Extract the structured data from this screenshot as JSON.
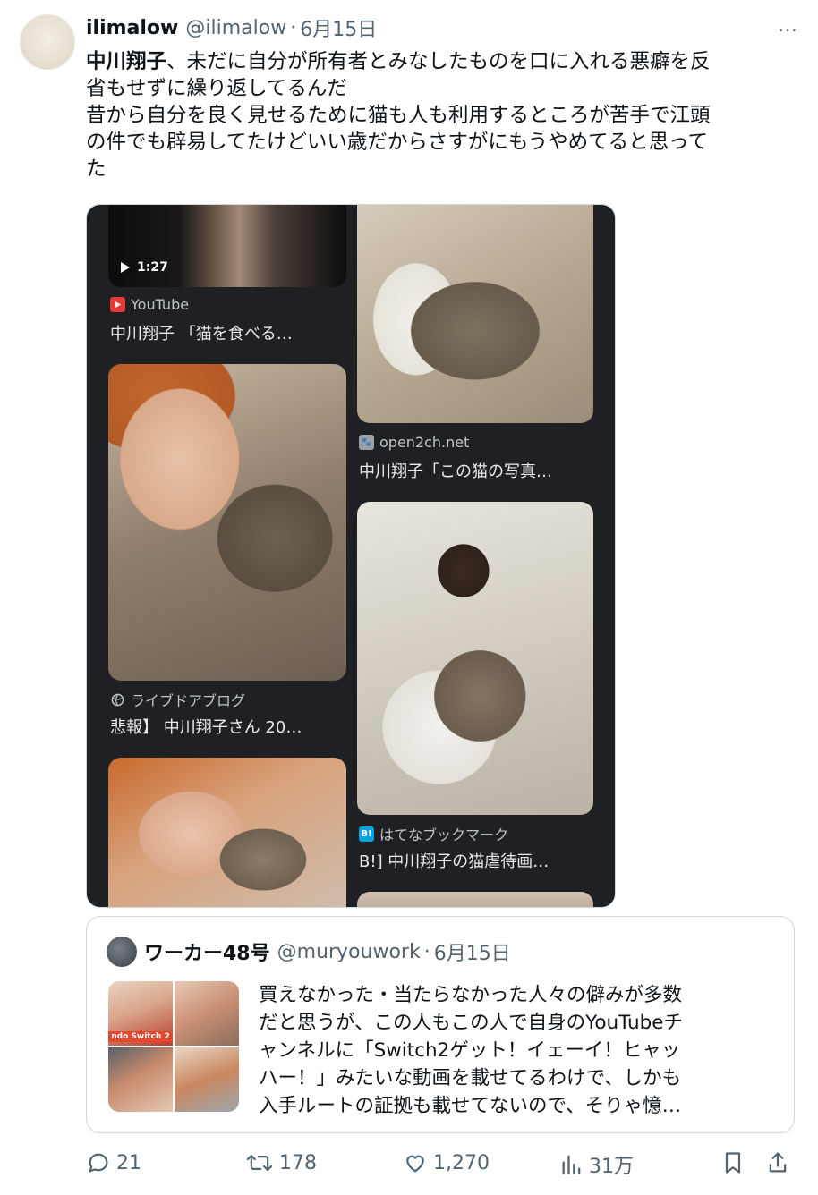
{
  "tweet": {
    "display_name": "ilimalow",
    "handle": "@ilimalow",
    "separator": "·",
    "date": "6月15日",
    "more_icon": "…",
    "text_bold": "中川翔子",
    "text_line1_rest": "、未だに自分が所有者とみなしたものを口に入れる悪癖を反",
    "text_line2": "省もせずに繰り返してるんだ",
    "text_line3": "昔から自分を良く見せるために猫も人も利用するところが苦手で江頭",
    "text_line4": "の件でも辟易してたけどいい歳だからさすがにもうやめてると思って",
    "text_line5": "た"
  },
  "media": {
    "video_duration": "1:27",
    "results": [
      {
        "source": "YouTube",
        "source_icon": "youtube-icon",
        "caption": "中川翔子 「猫を食べる…"
      },
      {
        "source": "open2ch.net",
        "source_icon": "open2ch-icon",
        "caption": "中川翔子「この猫の写真…"
      },
      {
        "source": "ライブドアブログ",
        "source_icon": "globe-icon",
        "caption": "悲報】 中川翔子さん 20…"
      },
      {
        "source": "はてなブックマーク",
        "source_icon": "hatena-bookmark-icon",
        "caption": "B!] 中川翔子の猫虐待画…"
      }
    ]
  },
  "quote": {
    "display_name": "ワーカー48号",
    "handle": "@muryouwork",
    "separator": "·",
    "date": "6月15日",
    "thumb_banner": "ndo Switch 2",
    "lines": [
      "買えなかった・当たらなかった人々の僻みが多数",
      "だと思うが、この人もこの人で自身のYouTubeチ",
      "ャンネルに「Switch2ゲット！イェーイ！ヒャッ",
      "ハー！」みたいな動画を載せてるわけで、しかも",
      "入手ルートの証拠も載せてないので、そりゃ憶…"
    ]
  },
  "actions": {
    "replies": "21",
    "reposts": "178",
    "likes": "1,270",
    "views": "31万"
  },
  "colors": {
    "text": "#0f1419",
    "muted": "#536471",
    "border": "#cfd9de",
    "media_bg": "#1f2023"
  }
}
